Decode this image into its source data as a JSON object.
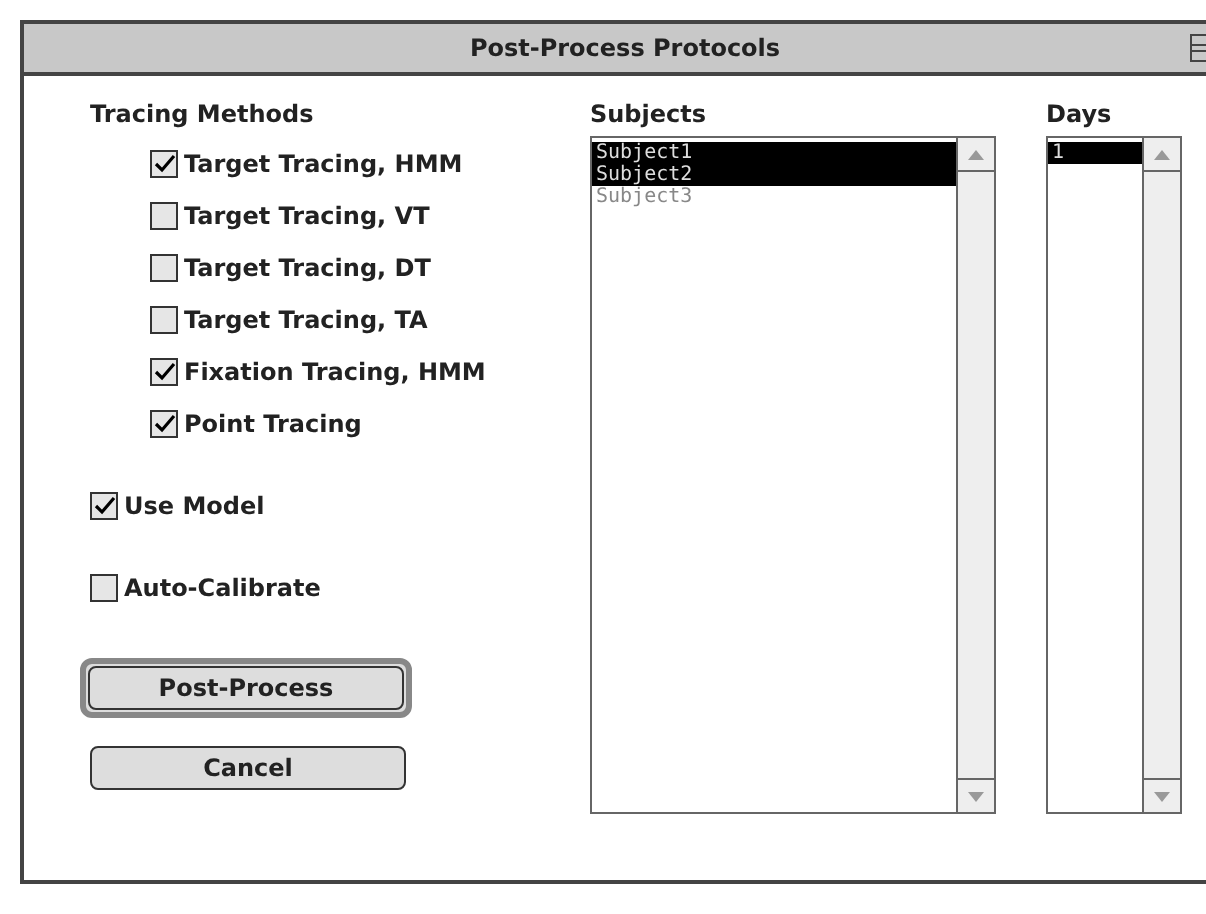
{
  "window": {
    "title": "Post-Process Protocols"
  },
  "tracing_methods": {
    "label": "Tracing Methods",
    "items": [
      {
        "label": "Target Tracing, HMM",
        "checked": true
      },
      {
        "label": "Target Tracing, VT",
        "checked": false
      },
      {
        "label": "Target Tracing, DT",
        "checked": false
      },
      {
        "label": "Target Tracing, TA",
        "checked": false
      },
      {
        "label": "Fixation Tracing, HMM",
        "checked": true
      },
      {
        "label": "Point Tracing",
        "checked": true
      }
    ]
  },
  "options": [
    {
      "label": "Use Model",
      "checked": true
    },
    {
      "label": "Auto-Calibrate",
      "checked": false
    }
  ],
  "buttons": [
    {
      "label": "Post-Process",
      "default": true
    },
    {
      "label": "Cancel",
      "default": false
    }
  ],
  "subjects": {
    "label": "Subjects",
    "items": [
      {
        "label": "Subject1",
        "selected": true
      },
      {
        "label": "Subject2",
        "selected": true
      },
      {
        "label": "Subject3",
        "selected": false
      }
    ]
  },
  "days": {
    "label": "Days",
    "items": [
      {
        "label": "1",
        "selected": true
      }
    ]
  }
}
